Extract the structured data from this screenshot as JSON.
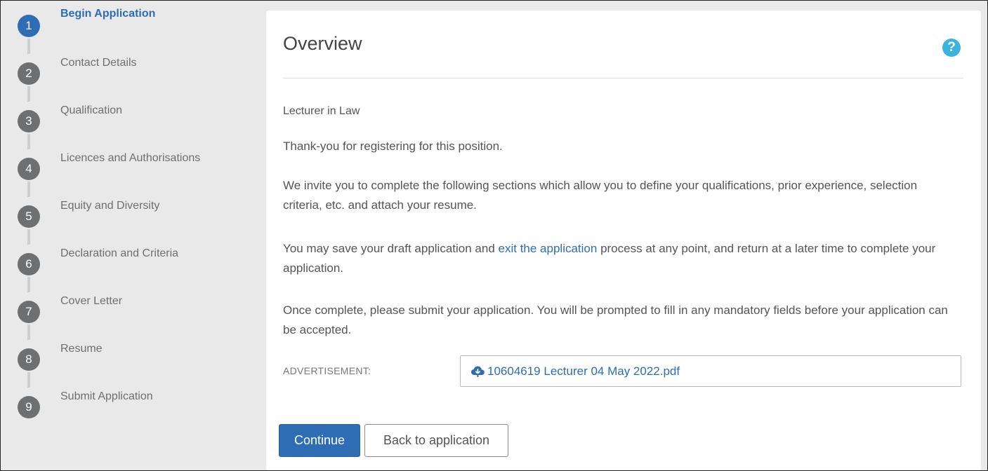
{
  "steps": [
    {
      "number": "1",
      "label": "Begin Application",
      "active": true
    },
    {
      "number": "2",
      "label": "Contact Details"
    },
    {
      "number": "3",
      "label": "Qualification"
    },
    {
      "number": "4",
      "label": "Licences and Authorisations"
    },
    {
      "number": "5",
      "label": "Equity and Diversity"
    },
    {
      "number": "6",
      "label": "Declaration and Criteria"
    },
    {
      "number": "7",
      "label": "Cover Letter"
    },
    {
      "number": "8",
      "label": "Resume"
    },
    {
      "number": "9",
      "label": "Submit Application"
    }
  ],
  "overview": {
    "title": "Overview",
    "help_icon": "?",
    "job_title": "Lecturer in Law",
    "thanks": "Thank-you for registering for this position.",
    "invite": "We invite you to complete the following sections which allow you to define your qualifications, prior experience, selection criteria, etc. and attach your resume.",
    "save_before": "You may save your draft application and ",
    "save_link": "exit the application",
    "save_after": " process at any point, and return at a later time to complete your application.",
    "once": "Once complete, please submit your application. You will be prompted to fill in any mandatory fields before your application can be accepted.",
    "advertisement_label": "ADVERTISEMENT:",
    "advertisement_file": "10604619 Lecturer 04 May 2022.pdf",
    "advertisement_icon": "cloud-download-icon"
  },
  "buttons": {
    "continue": "Continue",
    "back": "Back to application"
  },
  "colors": {
    "accent": "#2e6db4",
    "step_inactive": "#6d6f71",
    "help": "#3ab3dd"
  }
}
